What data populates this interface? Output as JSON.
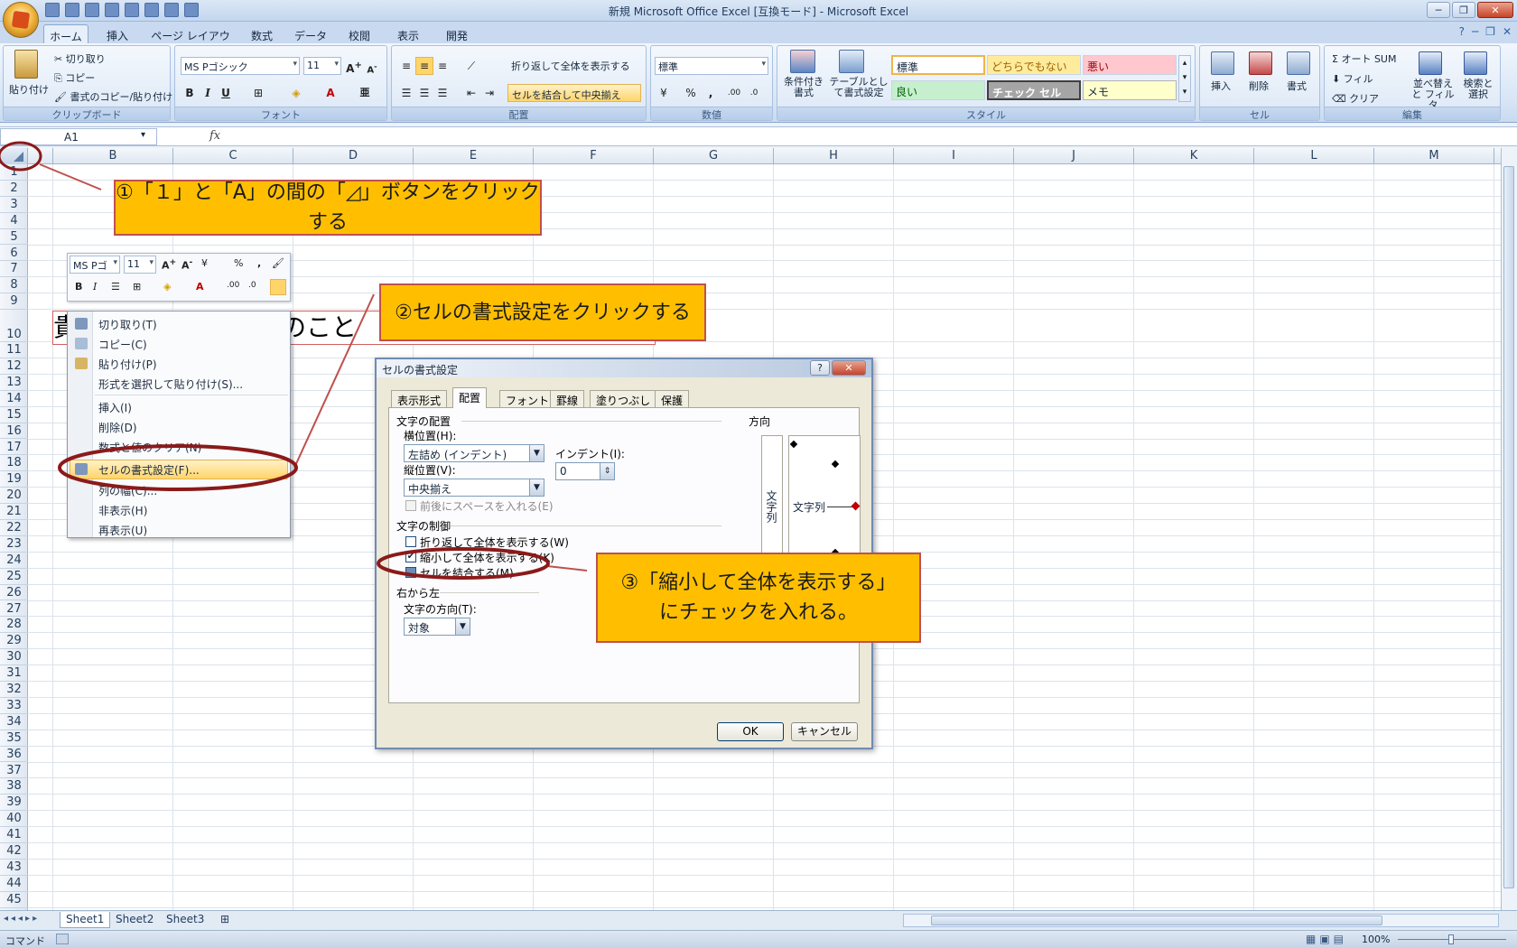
{
  "window": {
    "title": "新規 Microsoft Office Excel [互換モード] - Microsoft Excel",
    "minimize": "─",
    "restore": "❐",
    "close": "✕"
  },
  "ribbon_tabs": [
    "ホーム",
    "挿入",
    "ページ レイアウト",
    "数式",
    "データ",
    "校閲",
    "表示",
    "開発"
  ],
  "ribbon": {
    "clipboard": {
      "label": "クリップボード",
      "paste": "貼り付け",
      "cut": "切り取り",
      "copy": "コピー",
      "format_painter": "書式のコピー/貼り付け"
    },
    "font": {
      "label": "フォント",
      "font_name": "MS Pゴシック",
      "font_size": "11"
    },
    "alignment": {
      "label": "配置",
      "wrap": "折り返して全体を表示する",
      "merge": "セルを結合して中央揃え"
    },
    "number": {
      "label": "数値",
      "format": "標準"
    },
    "styles": {
      "label": "スタイル",
      "conditional": "条件付き書式",
      "as_table": "テーブルとして書式設定",
      "cells": [
        "標準",
        "どちらでもない",
        "悪い",
        "良い",
        "チェック セル",
        "メモ"
      ]
    },
    "cells": {
      "label": "セル",
      "insert": "挿入",
      "delete": "削除",
      "format": "書式"
    },
    "editing": {
      "label": "編集",
      "autosum": "Σ オート SUM",
      "fill": "フィル",
      "clear": "クリア",
      "sort": "並べ替えと フィルタ",
      "find": "検索と 選択"
    }
  },
  "formula_bar": {
    "name_box": "A1",
    "fx": "fx",
    "value": ""
  },
  "grid": {
    "columns": [
      "",
      "B",
      "C",
      "D",
      "E",
      "F",
      "G",
      "H",
      "I",
      "J",
      "K",
      "L",
      "M"
    ],
    "rows": [
      "1",
      "2",
      "3",
      "4",
      "5",
      "6",
      "7",
      "8",
      "9",
      "10",
      "11",
      "12",
      "13",
      "14",
      "15",
      "16",
      "17",
      "18",
      "19",
      "20",
      "21",
      "22",
      "23",
      "24",
      "25",
      "26",
      "27",
      "28",
      "29",
      "30",
      "31",
      "32",
      "33",
      "34",
      "35",
      "36",
      "37",
      "38",
      "39",
      "40",
      "41",
      "42",
      "43",
      "44",
      "45"
    ],
    "cell_text_visible": "貴　　　　　　　様のこと"
  },
  "mini_toolbar": {
    "font": "MS Pゴ",
    "size": "11"
  },
  "context_menu": {
    "items": [
      "切り取り(T)",
      "コピー(C)",
      "貼り付け(P)",
      "形式を選択して貼り付け(S)...",
      "挿入(I)",
      "削除(D)",
      "数式と値のクリア(N)",
      "セルの書式設定(F)...",
      "列の幅(C)...",
      "非表示(H)",
      "再表示(U)"
    ]
  },
  "dialog": {
    "title": "セルの書式設定",
    "help": "?",
    "close": "✕",
    "tabs": [
      "表示形式",
      "配置",
      "フォント",
      "罫線",
      "塗りつぶし",
      "保護"
    ],
    "active_tab": "配置",
    "text_alignment": "文字の配置",
    "horizontal_label": "横位置(H):",
    "horizontal_value": "左詰め (インデント)",
    "vertical_label": "縦位置(V):",
    "vertical_value": "中央揃え",
    "indent_label": "インデント(I):",
    "indent_value": "0",
    "justify_distributed": "前後にスペースを入れる(E)",
    "text_control": "文字の制御",
    "wrap_text": "折り返して全体を表示する(W)",
    "shrink_to_fit": "縮小して全体を表示する(K)",
    "merge_cells": "セルを結合する(M)",
    "rtl": "右から左",
    "direction_label": "文字の方向(T):",
    "direction_value": "対象",
    "orientation": "方向",
    "orientation_vertical": "文字列",
    "orientation_text": "文字列",
    "ok": "OK",
    "cancel": "キャンセル",
    "shrink_checked": true
  },
  "annotations": {
    "step1": "①「１」と「A」の間の「◿」ボタンをクリックする",
    "step2": "②セルの書式設定をクリックする",
    "step3": "③「縮小して全体を表示する」\nにチェックを入れる。"
  },
  "sheets": [
    "Sheet1",
    "Sheet2",
    "Sheet3"
  ],
  "status": {
    "mode": "コマンド",
    "zoom": "100%"
  },
  "colors": {
    "callout": "#ffbf00",
    "ellipse": "#8b1a1a",
    "highlight": "#ffd56a"
  }
}
